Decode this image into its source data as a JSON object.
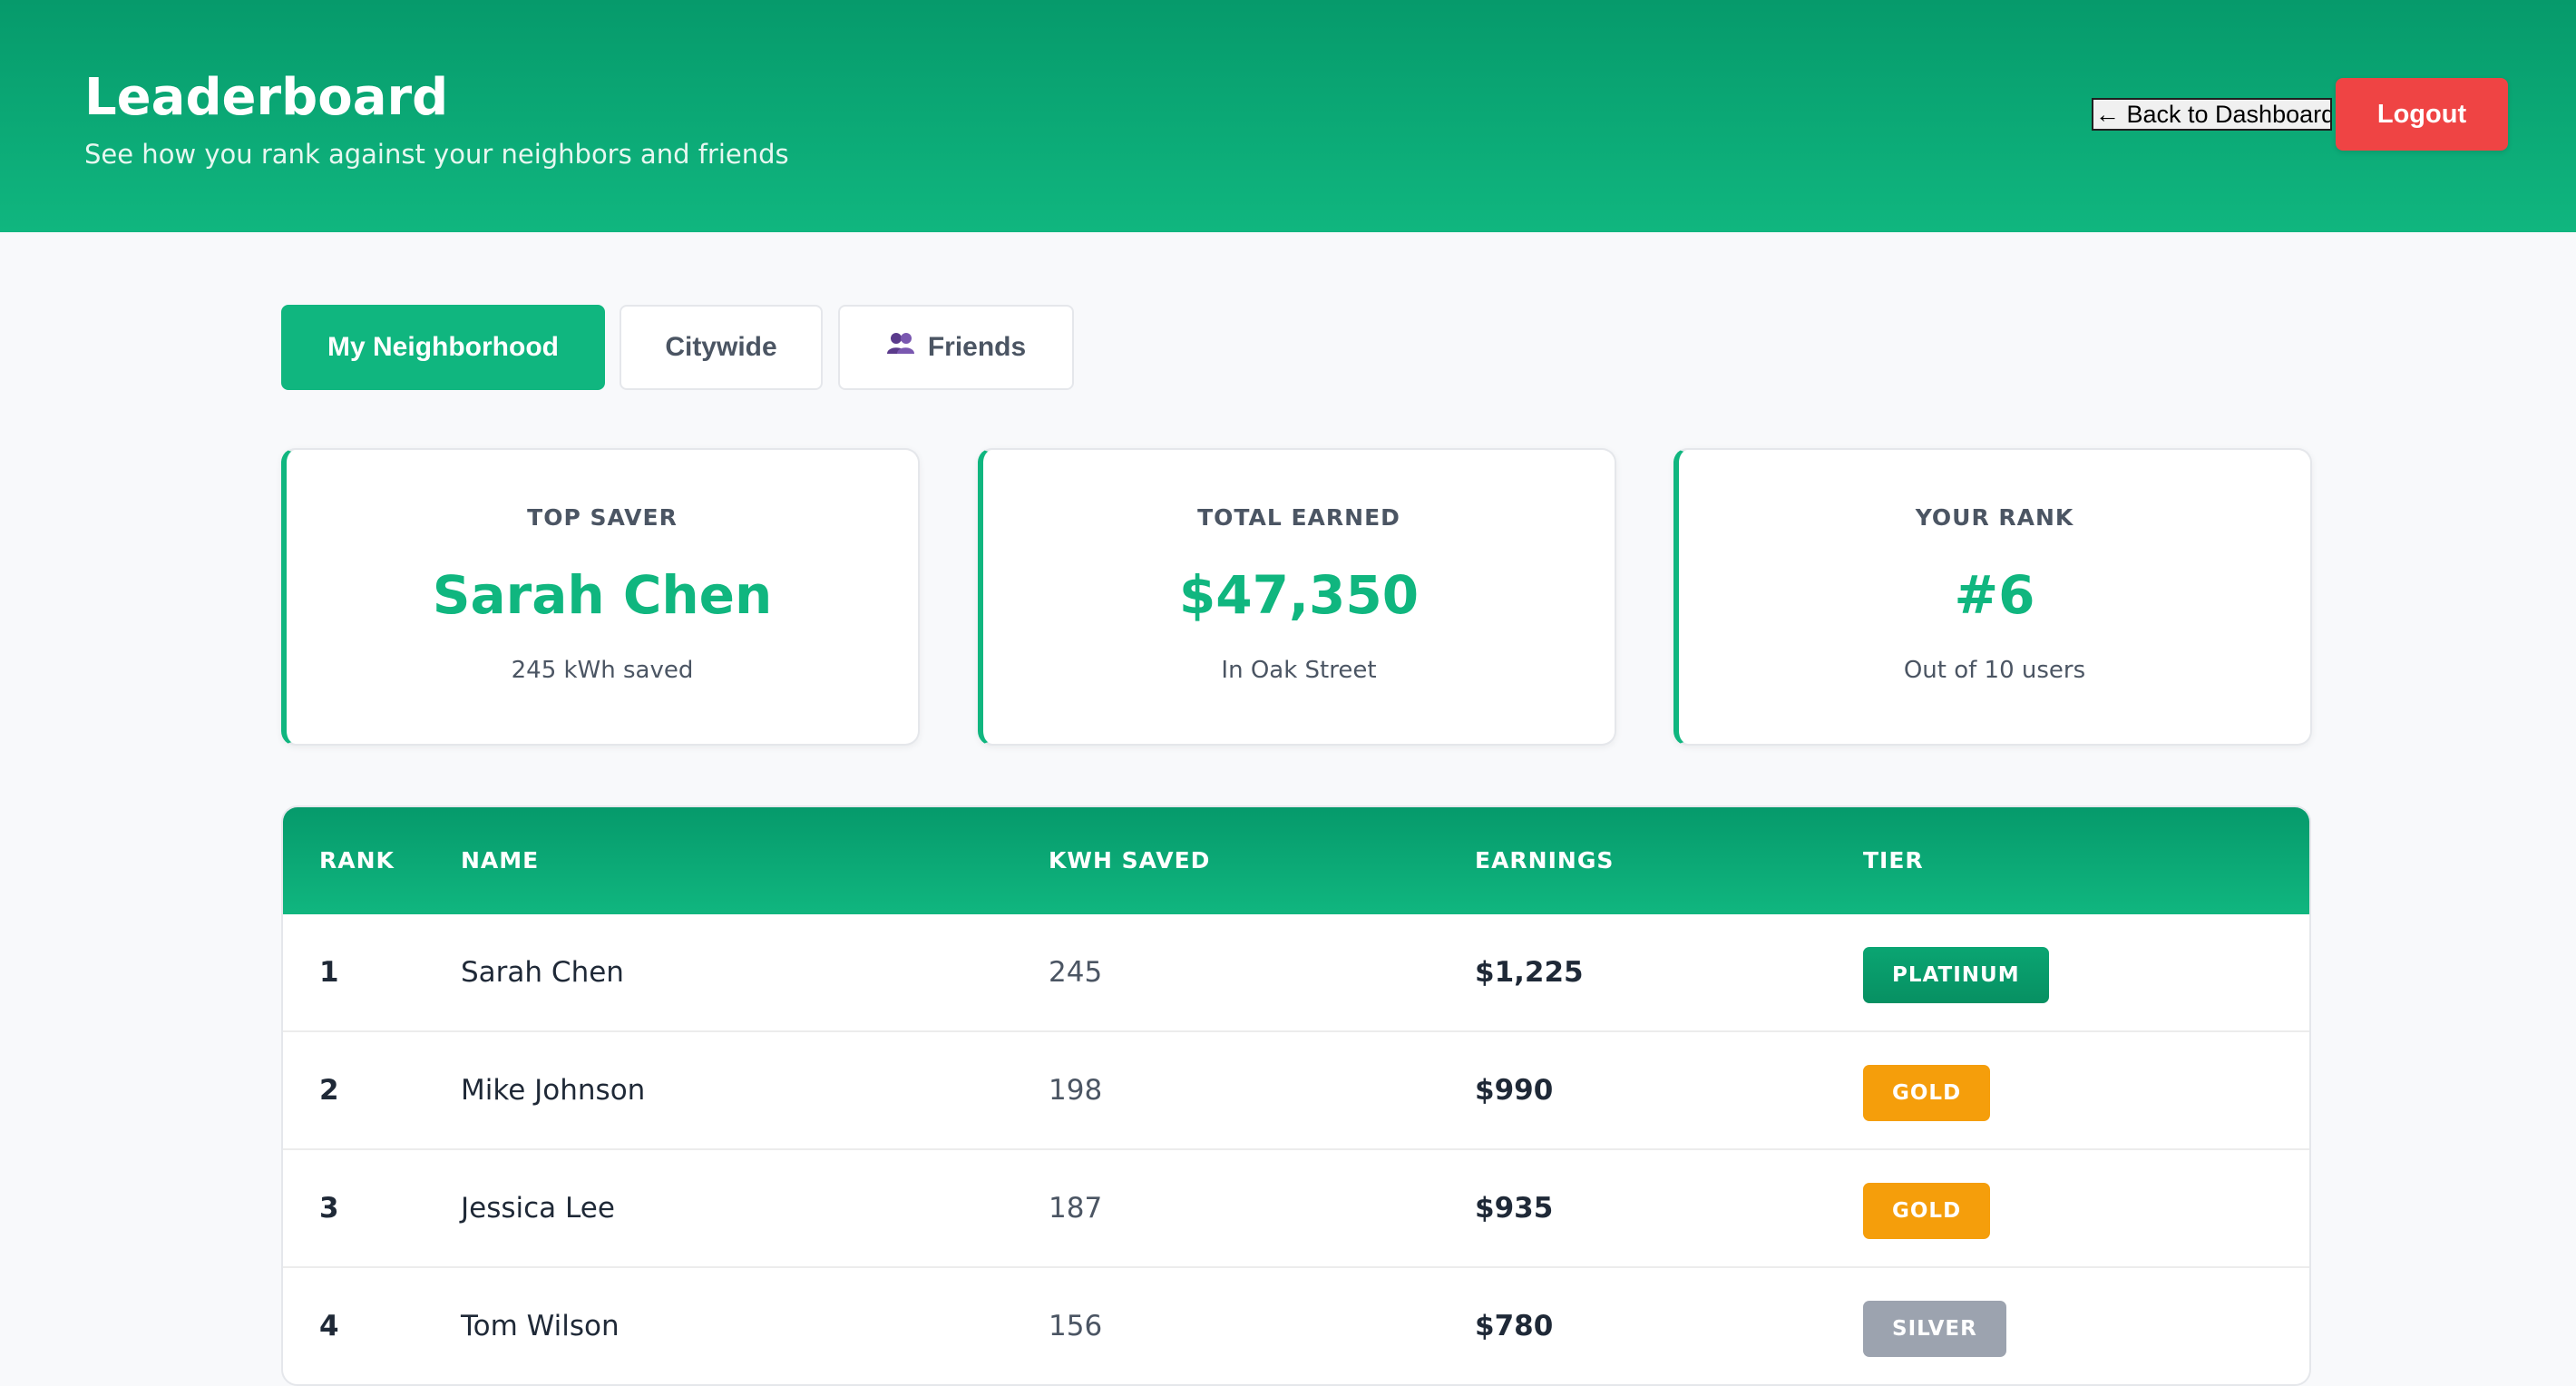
{
  "header": {
    "title": "Leaderboard",
    "subtitle": "See how you rank against your neighbors and friends",
    "back_label": "← Back to Dashboard",
    "logout_label": "Logout"
  },
  "tabs": [
    {
      "label": "My Neighborhood",
      "active": true
    },
    {
      "label": "Citywide",
      "active": false
    },
    {
      "label": "Friends",
      "active": false,
      "icon": "people-icon"
    }
  ],
  "stats": [
    {
      "label": "TOP SAVER",
      "value": "Sarah Chen",
      "sub": "245 kWh saved"
    },
    {
      "label": "TOTAL EARNED",
      "value": "$47,350",
      "sub": "In Oak Street"
    },
    {
      "label": "YOUR RANK",
      "value": "#6",
      "sub": "Out of 10 users"
    }
  ],
  "table": {
    "columns": [
      "RANK",
      "NAME",
      "KWH SAVED",
      "EARNINGS",
      "TIER"
    ],
    "rows": [
      {
        "rank": "1",
        "name": "Sarah Chen",
        "kwh": "245",
        "earnings": "$1,225",
        "tier": "PLATINUM"
      },
      {
        "rank": "2",
        "name": "Mike Johnson",
        "kwh": "198",
        "earnings": "$990",
        "tier": "GOLD"
      },
      {
        "rank": "3",
        "name": "Jessica Lee",
        "kwh": "187",
        "earnings": "$935",
        "tier": "GOLD"
      },
      {
        "rank": "4",
        "name": "Tom Wilson",
        "kwh": "156",
        "earnings": "$780",
        "tier": "SILVER"
      }
    ]
  },
  "colors": {
    "brand": "#10b67f",
    "brand_dark": "#069a6b",
    "logout": "#ef4444",
    "platinum": "#0aa572",
    "gold": "#f59e0b",
    "silver": "#9ca3af"
  }
}
